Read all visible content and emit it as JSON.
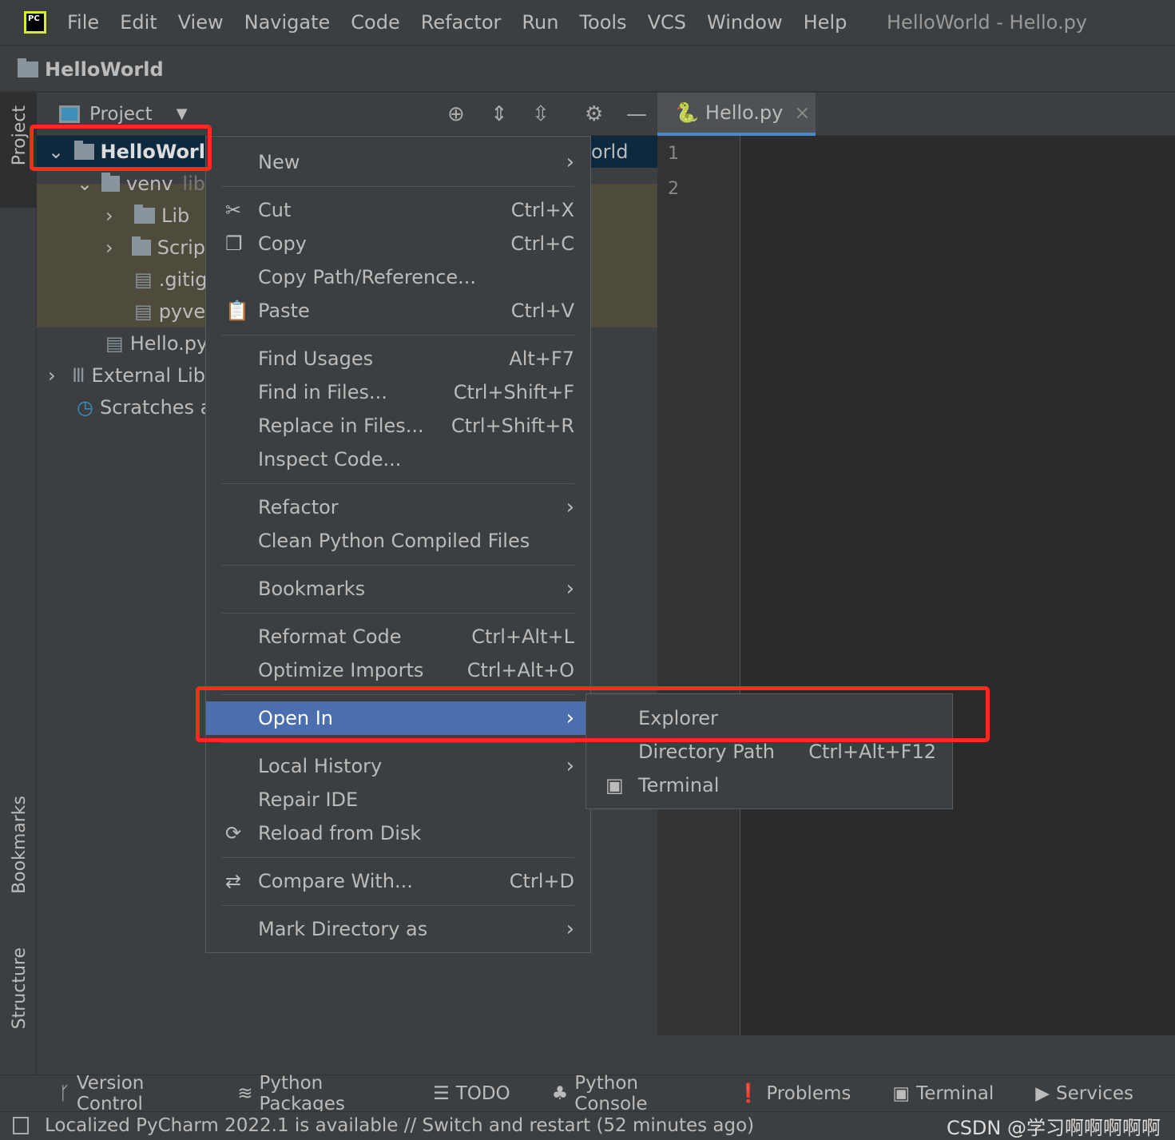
{
  "window_title": "HelloWorld - Hello.py",
  "menu": [
    "File",
    "Edit",
    "View",
    "Navigate",
    "Code",
    "Refactor",
    "Run",
    "Tools",
    "VCS",
    "Window",
    "Help"
  ],
  "logo": "PC",
  "breadcrumb": "HelloWorld",
  "left_stripe": {
    "project": "Project",
    "bookmarks": "Bookmarks",
    "structure": "Structure"
  },
  "project_panel": {
    "title": "Project"
  },
  "tree": [
    {
      "label": "HelloWorl",
      "icon": "folder-icon",
      "expand": "⌄"
    },
    {
      "label": "venv",
      "extra": "lib",
      "icon": "folder-icon",
      "expand": "⌄"
    },
    {
      "label": "Lib",
      "icon": "folder-icon",
      "expand": "›"
    },
    {
      "label": "Scrip",
      "icon": "folder-icon",
      "expand": "›"
    },
    {
      "label": ".gitig",
      "icon": "file-icon"
    },
    {
      "label": "pyve",
      "icon": "file-icon"
    },
    {
      "label": "Hello.py",
      "icon": "python-file-icon"
    },
    {
      "label": "External Lib",
      "icon": "library-icon",
      "expand": "›"
    },
    {
      "label": "Scratches a",
      "icon": "scratches-icon"
    }
  ],
  "tree_right_fragment": "orld",
  "editor": {
    "tab": "Hello.py",
    "lines": [
      "1",
      "2"
    ]
  },
  "context_menu": [
    {
      "label": "New",
      "submenu": true
    },
    {
      "sep": true
    },
    {
      "label": "Cut",
      "shortcut": "Ctrl+X",
      "icon": "✂"
    },
    {
      "label": "Copy",
      "shortcut": "Ctrl+C",
      "icon": "❐"
    },
    {
      "label": "Copy Path/Reference..."
    },
    {
      "label": "Paste",
      "shortcut": "Ctrl+V",
      "icon": "📋"
    },
    {
      "sep": true
    },
    {
      "label": "Find Usages",
      "shortcut": "Alt+F7"
    },
    {
      "label": "Find in Files...",
      "shortcut": "Ctrl+Shift+F"
    },
    {
      "label": "Replace in Files...",
      "shortcut": "Ctrl+Shift+R"
    },
    {
      "label": "Inspect Code..."
    },
    {
      "sep": true
    },
    {
      "label": "Refactor",
      "submenu": true
    },
    {
      "label": "Clean Python Compiled Files"
    },
    {
      "sep": true
    },
    {
      "label": "Bookmarks",
      "submenu": true
    },
    {
      "sep": true
    },
    {
      "label": "Reformat Code",
      "shortcut": "Ctrl+Alt+L"
    },
    {
      "label": "Optimize Imports",
      "shortcut": "Ctrl+Alt+O"
    },
    {
      "sep": true
    },
    {
      "label": "Open In",
      "submenu": true,
      "selected": true
    },
    {
      "sep": true
    },
    {
      "label": "Local History",
      "submenu": true
    },
    {
      "label": "Repair IDE"
    },
    {
      "label": "Reload from Disk",
      "icon": "⟳"
    },
    {
      "sep": true
    },
    {
      "label": "Compare With...",
      "shortcut": "Ctrl+D",
      "icon": "⇄"
    },
    {
      "sep": true
    },
    {
      "label": "Mark Directory as",
      "submenu": true
    }
  ],
  "submenu": [
    {
      "label": "Explorer"
    },
    {
      "label": "Directory Path",
      "shortcut": "Ctrl+Alt+F12"
    },
    {
      "label": "Terminal",
      "icon": "▣"
    }
  ],
  "bottom_tools": [
    {
      "label": "Version Control",
      "icon": "ᚴ"
    },
    {
      "label": "Python Packages",
      "icon": "≋"
    },
    {
      "label": "TODO",
      "icon": "☰"
    },
    {
      "label": "Python Console",
      "icon": "♣"
    },
    {
      "label": "Problems",
      "icon": "❗"
    },
    {
      "label": "Terminal",
      "icon": "▣"
    },
    {
      "label": "Services",
      "icon": "▶"
    }
  ],
  "status": "Localized PyCharm 2022.1 is available // Switch and restart (52 minutes ago)",
  "watermark": "CSDN @学习啊啊啊啊啊",
  "colors": {
    "selection": "#4b6eaf",
    "highlight_box": "#ff2a1a",
    "tree_selected": "#0d293e"
  }
}
